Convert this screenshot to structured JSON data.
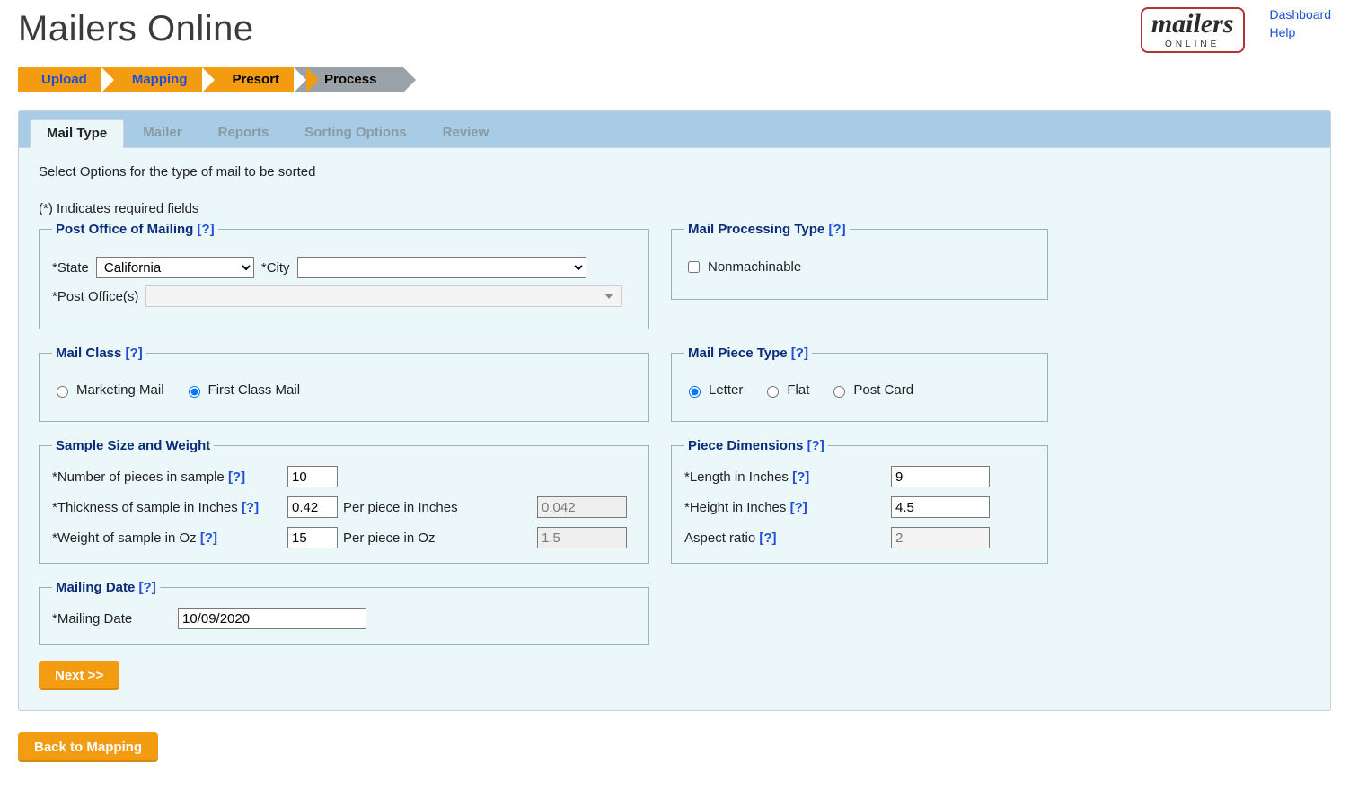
{
  "header": {
    "title": "Mailers Online",
    "links": {
      "dashboard": "Dashboard",
      "help": "Help"
    },
    "logo": {
      "main": "mailers",
      "sub": "ONLINE"
    }
  },
  "steps": {
    "upload": "Upload",
    "mapping": "Mapping",
    "presort": "Presort",
    "process": "Process"
  },
  "tabs": {
    "mail_type": "Mail Type",
    "mailer": "Mailer",
    "reports": "Reports",
    "sorting_options": "Sorting Options",
    "review": "Review"
  },
  "intro": "Select Options for the type of mail to be sorted",
  "required_note": "(*) Indicates required fields",
  "post_office": {
    "legend": "Post Office of Mailing",
    "state_label": "*State",
    "state_value": "California",
    "city_label": "*City",
    "city_value": "",
    "post_offices_label": "*Post Office(s)",
    "post_offices_value": ""
  },
  "mail_class": {
    "legend": "Mail Class",
    "marketing": "Marketing Mail",
    "first_class": "First Class Mail",
    "selected": "first_class"
  },
  "sample": {
    "legend": "Sample Size and Weight",
    "num_label": "*Number of pieces in sample",
    "num_value": "10",
    "thick_label": "*Thickness of sample in Inches",
    "thick_value": "0.42",
    "per_thick_label": "Per piece in Inches",
    "per_thick_value": "0.042",
    "weight_label": "*Weight of sample in Oz",
    "weight_value": "15",
    "per_weight_label": "Per piece in Oz",
    "per_weight_value": "1.5"
  },
  "mailing_date": {
    "legend": "Mailing Date",
    "label": "*Mailing Date",
    "value": "10/09/2020"
  },
  "processing_type": {
    "legend": "Mail Processing Type",
    "nonmachinable": "Nonmachinable",
    "nonmachinable_checked": false
  },
  "piece_type": {
    "legend": "Mail Piece Type",
    "letter": "Letter",
    "flat": "Flat",
    "postcard": "Post Card",
    "selected": "letter"
  },
  "dimensions": {
    "legend": "Piece Dimensions",
    "length_label": "*Length in Inches",
    "length_value": "9",
    "height_label": "*Height in Inches",
    "height_value": "4.5",
    "aspect_label": "Aspect ratio",
    "aspect_value": "2"
  },
  "buttons": {
    "next": "Next >>",
    "back": "Back to Mapping"
  },
  "help_glyph": "[?]"
}
